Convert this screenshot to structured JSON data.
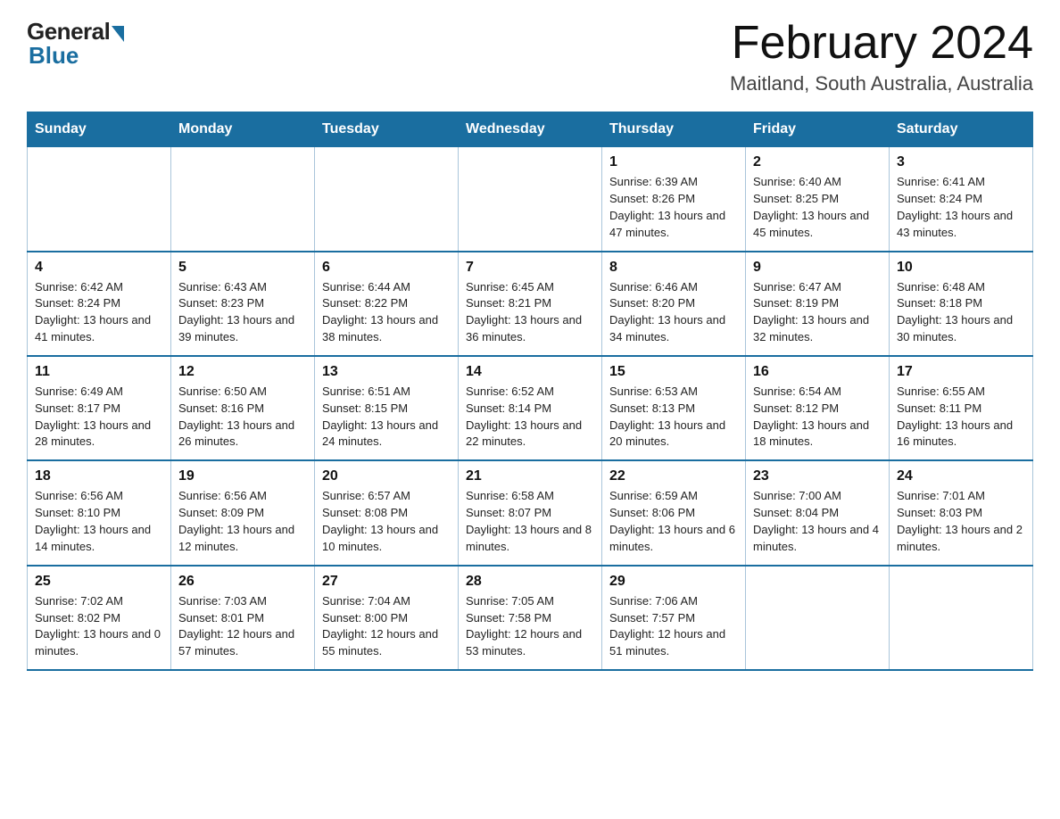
{
  "header": {
    "logo_general": "General",
    "logo_blue": "Blue",
    "title": "February 2024",
    "location": "Maitland, South Australia, Australia"
  },
  "days_of_week": [
    "Sunday",
    "Monday",
    "Tuesday",
    "Wednesday",
    "Thursday",
    "Friday",
    "Saturday"
  ],
  "weeks": [
    [
      {
        "day": "",
        "info": ""
      },
      {
        "day": "",
        "info": ""
      },
      {
        "day": "",
        "info": ""
      },
      {
        "day": "",
        "info": ""
      },
      {
        "day": "1",
        "info": "Sunrise: 6:39 AM\nSunset: 8:26 PM\nDaylight: 13 hours and 47 minutes."
      },
      {
        "day": "2",
        "info": "Sunrise: 6:40 AM\nSunset: 8:25 PM\nDaylight: 13 hours and 45 minutes."
      },
      {
        "day": "3",
        "info": "Sunrise: 6:41 AM\nSunset: 8:24 PM\nDaylight: 13 hours and 43 minutes."
      }
    ],
    [
      {
        "day": "4",
        "info": "Sunrise: 6:42 AM\nSunset: 8:24 PM\nDaylight: 13 hours and 41 minutes."
      },
      {
        "day": "5",
        "info": "Sunrise: 6:43 AM\nSunset: 8:23 PM\nDaylight: 13 hours and 39 minutes."
      },
      {
        "day": "6",
        "info": "Sunrise: 6:44 AM\nSunset: 8:22 PM\nDaylight: 13 hours and 38 minutes."
      },
      {
        "day": "7",
        "info": "Sunrise: 6:45 AM\nSunset: 8:21 PM\nDaylight: 13 hours and 36 minutes."
      },
      {
        "day": "8",
        "info": "Sunrise: 6:46 AM\nSunset: 8:20 PM\nDaylight: 13 hours and 34 minutes."
      },
      {
        "day": "9",
        "info": "Sunrise: 6:47 AM\nSunset: 8:19 PM\nDaylight: 13 hours and 32 minutes."
      },
      {
        "day": "10",
        "info": "Sunrise: 6:48 AM\nSunset: 8:18 PM\nDaylight: 13 hours and 30 minutes."
      }
    ],
    [
      {
        "day": "11",
        "info": "Sunrise: 6:49 AM\nSunset: 8:17 PM\nDaylight: 13 hours and 28 minutes."
      },
      {
        "day": "12",
        "info": "Sunrise: 6:50 AM\nSunset: 8:16 PM\nDaylight: 13 hours and 26 minutes."
      },
      {
        "day": "13",
        "info": "Sunrise: 6:51 AM\nSunset: 8:15 PM\nDaylight: 13 hours and 24 minutes."
      },
      {
        "day": "14",
        "info": "Sunrise: 6:52 AM\nSunset: 8:14 PM\nDaylight: 13 hours and 22 minutes."
      },
      {
        "day": "15",
        "info": "Sunrise: 6:53 AM\nSunset: 8:13 PM\nDaylight: 13 hours and 20 minutes."
      },
      {
        "day": "16",
        "info": "Sunrise: 6:54 AM\nSunset: 8:12 PM\nDaylight: 13 hours and 18 minutes."
      },
      {
        "day": "17",
        "info": "Sunrise: 6:55 AM\nSunset: 8:11 PM\nDaylight: 13 hours and 16 minutes."
      }
    ],
    [
      {
        "day": "18",
        "info": "Sunrise: 6:56 AM\nSunset: 8:10 PM\nDaylight: 13 hours and 14 minutes."
      },
      {
        "day": "19",
        "info": "Sunrise: 6:56 AM\nSunset: 8:09 PM\nDaylight: 13 hours and 12 minutes."
      },
      {
        "day": "20",
        "info": "Sunrise: 6:57 AM\nSunset: 8:08 PM\nDaylight: 13 hours and 10 minutes."
      },
      {
        "day": "21",
        "info": "Sunrise: 6:58 AM\nSunset: 8:07 PM\nDaylight: 13 hours and 8 minutes."
      },
      {
        "day": "22",
        "info": "Sunrise: 6:59 AM\nSunset: 8:06 PM\nDaylight: 13 hours and 6 minutes."
      },
      {
        "day": "23",
        "info": "Sunrise: 7:00 AM\nSunset: 8:04 PM\nDaylight: 13 hours and 4 minutes."
      },
      {
        "day": "24",
        "info": "Sunrise: 7:01 AM\nSunset: 8:03 PM\nDaylight: 13 hours and 2 minutes."
      }
    ],
    [
      {
        "day": "25",
        "info": "Sunrise: 7:02 AM\nSunset: 8:02 PM\nDaylight: 13 hours and 0 minutes."
      },
      {
        "day": "26",
        "info": "Sunrise: 7:03 AM\nSunset: 8:01 PM\nDaylight: 12 hours and 57 minutes."
      },
      {
        "day": "27",
        "info": "Sunrise: 7:04 AM\nSunset: 8:00 PM\nDaylight: 12 hours and 55 minutes."
      },
      {
        "day": "28",
        "info": "Sunrise: 7:05 AM\nSunset: 7:58 PM\nDaylight: 12 hours and 53 minutes."
      },
      {
        "day": "29",
        "info": "Sunrise: 7:06 AM\nSunset: 7:57 PM\nDaylight: 12 hours and 51 minutes."
      },
      {
        "day": "",
        "info": ""
      },
      {
        "day": "",
        "info": ""
      }
    ]
  ]
}
